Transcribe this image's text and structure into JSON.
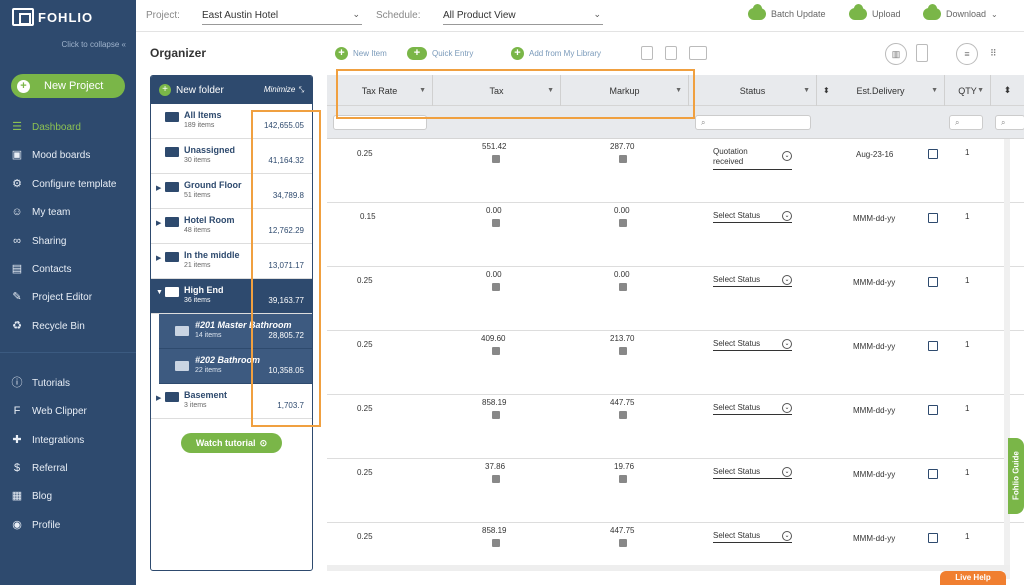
{
  "app": {
    "logo": "FOHLIO",
    "collapse_label": "Click to collapse"
  },
  "sidebar": {
    "new_project": "New Project",
    "items": [
      {
        "label": "Dashboard",
        "icon": "dashboard-icon"
      },
      {
        "label": "Mood boards",
        "icon": "moodboard-icon"
      },
      {
        "label": "Configure template",
        "icon": "gear-icon"
      },
      {
        "label": "My team",
        "icon": "team-icon"
      },
      {
        "label": "Sharing",
        "icon": "share-icon"
      },
      {
        "label": "Contacts",
        "icon": "contacts-icon"
      },
      {
        "label": "Project Editor",
        "icon": "edit-icon"
      },
      {
        "label": "Recycle Bin",
        "icon": "recycle-icon"
      }
    ],
    "bottom_items": [
      {
        "label": "Tutorials",
        "icon": "info-icon"
      },
      {
        "label": "Web Clipper",
        "icon": "webclipper-icon"
      },
      {
        "label": "Integrations",
        "icon": "puzzle-icon"
      },
      {
        "label": "Referral",
        "icon": "dollar-icon"
      },
      {
        "label": "Blog",
        "icon": "blog-icon"
      },
      {
        "label": "Profile",
        "icon": "profile-icon"
      }
    ]
  },
  "topbar": {
    "project_label": "Project:",
    "project_value": "East Austin Hotel",
    "schedule_label": "Schedule:",
    "schedule_value": "All Product View",
    "batch_update": "Batch Update",
    "upload": "Upload",
    "download": "Download"
  },
  "organizer": {
    "title": "Organizer",
    "new_folder": "New folder",
    "minimize": "Minimize",
    "folders": [
      {
        "name": "All Items",
        "count": "189 items",
        "amount": "142,655.05"
      },
      {
        "name": "Unassigned",
        "count": "30 items",
        "amount": "41,164.32"
      },
      {
        "name": "Ground Floor",
        "count": "51 items",
        "amount": "34,789.8"
      },
      {
        "name": "Hotel Room",
        "count": "48 items",
        "amount": "12,762.29"
      },
      {
        "name": "In the middle",
        "count": "21 items",
        "amount": "13,071.17"
      },
      {
        "name": "High End",
        "count": "36 items",
        "amount": "39,163.77"
      },
      {
        "name": "#201 Master Bathroom",
        "count": "14 items",
        "amount": "28,805.72"
      },
      {
        "name": "#202 Bathroom",
        "count": "22 items",
        "amount": "10,358.05"
      },
      {
        "name": "Basement",
        "count": "3 items",
        "amount": "1,703.7"
      }
    ],
    "watch_tutorial": "Watch tutorial"
  },
  "toolbar": {
    "new_item": "New Item",
    "quick_entry": "Quick Entry",
    "add_from_library": "Add from My Library"
  },
  "grid": {
    "columns": [
      "Tax Rate",
      "Tax",
      "Markup",
      "Status",
      "Est.Delivery",
      "QTY"
    ],
    "rows": [
      {
        "tax_rate": "0.25",
        "tax": "551.42",
        "markup": "287.70",
        "status": "Quotation received",
        "delivery": "Aug-23-16",
        "qty": "1"
      },
      {
        "tax_rate": "0.15",
        "tax": "0.00",
        "markup": "0.00",
        "status": "Select Status",
        "delivery": "MMM-dd-yy",
        "qty": "1"
      },
      {
        "tax_rate": "0.25",
        "tax": "0.00",
        "markup": "0.00",
        "status": "Select Status",
        "delivery": "MMM-dd-yy",
        "qty": "1"
      },
      {
        "tax_rate": "0.25",
        "tax": "409.60",
        "markup": "213.70",
        "status": "Select Status",
        "delivery": "MMM-dd-yy",
        "qty": "1"
      },
      {
        "tax_rate": "0.25",
        "tax": "858.19",
        "markup": "447.75",
        "status": "Select Status",
        "delivery": "MMM-dd-yy",
        "qty": "1"
      },
      {
        "tax_rate": "0.25",
        "tax": "37.86",
        "markup": "19.76",
        "status": "Select Status",
        "delivery": "MMM-dd-yy",
        "qty": "1"
      },
      {
        "tax_rate": "0.25",
        "tax": "858.19",
        "markup": "447.75",
        "status": "Select Status",
        "delivery": "MMM-dd-yy",
        "qty": "1"
      }
    ]
  },
  "guide": "Fohlio Guide",
  "live_help": "Live Help",
  "colors": {
    "accent": "#7ab648",
    "sidebar": "#2e4a6e",
    "highlight": "#f0a040"
  }
}
